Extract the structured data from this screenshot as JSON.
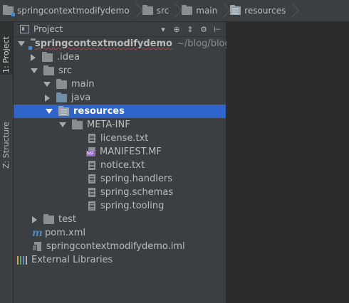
{
  "breadcrumb": {
    "items": [
      {
        "label": "springcontextmodifydemo",
        "icon": "module-folder-icon"
      },
      {
        "label": "src",
        "icon": "folder-icon"
      },
      {
        "label": "main",
        "icon": "folder-icon"
      },
      {
        "label": "resources",
        "icon": "resources-folder-icon"
      }
    ]
  },
  "side_tabs": {
    "project": "1: Project",
    "structure": "Z: Structure"
  },
  "panel": {
    "title": "Project",
    "title_dropdown_icon": "chevron-down-icon",
    "tools": [
      "target-icon",
      "collapse-icon",
      "gear-icon",
      "hide-icon"
    ]
  },
  "tree": {
    "root_label": "springcontextmodifydemo",
    "root_path": "~/blog/blog_c",
    "idea": ".idea",
    "src": "src",
    "main": "main",
    "java": "java",
    "resources": "resources",
    "meta_inf": "META-INF",
    "license": "license.txt",
    "manifest": "MANIFEST.MF",
    "manifest_badge": "MF",
    "notice": "notice.txt",
    "handlers": "spring.handlers",
    "schemas": "spring.schemas",
    "tooling": "spring.tooling",
    "test": "test",
    "pom": "pom.xml",
    "pom_glyph": "m",
    "iml": "springcontextmodifydemo.iml",
    "external_libraries": "External Libraries"
  },
  "colors": {
    "selection": "#2f65ca",
    "panel_bg": "#3c3f41",
    "editor_bg": "#2b2b2b",
    "text": "#bbbbbb",
    "path_text": "#8c8c8c",
    "source_folder": "#6f8faa",
    "maven_icon": "#4a88c7",
    "manifest_badge": "#8a63b8"
  }
}
